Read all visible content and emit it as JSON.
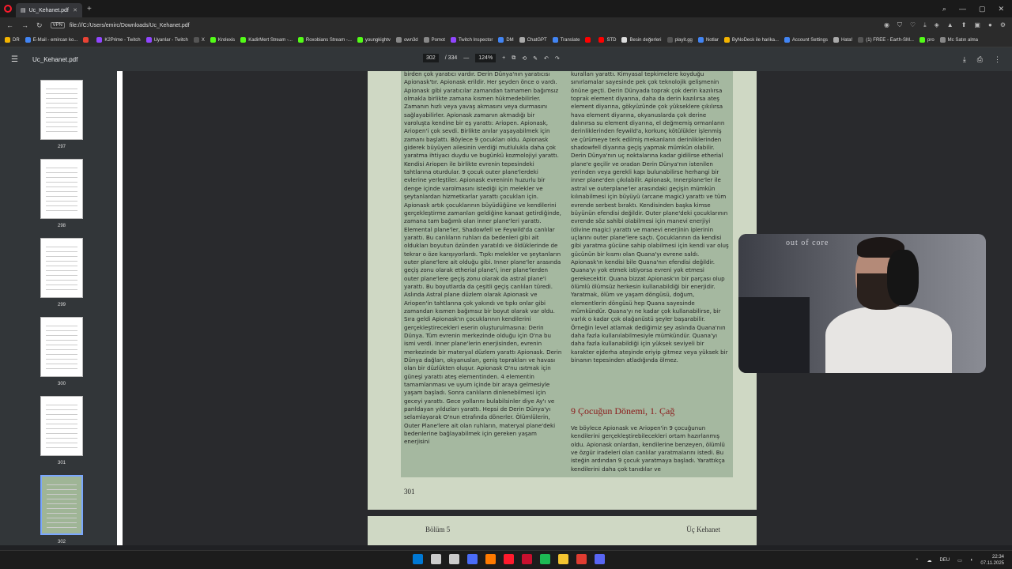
{
  "browser": {
    "tab_title": "Uc_Kehanet.pdf",
    "url": "file:///C:/Users/emirc/Downloads/Uc_Kehanet.pdf",
    "url_badge": "VPN"
  },
  "bookmarks": [
    {
      "label": "DR",
      "color": "#f4b400"
    },
    {
      "label": "E-Mail - emircan ko...",
      "color": "#4285f4"
    },
    {
      "label": "",
      "color": "#ea4335"
    },
    {
      "label": "K2Prime - Twitch",
      "color": "#9146ff"
    },
    {
      "label": "Uyarılar - Twitch",
      "color": "#9146ff"
    },
    {
      "label": "X",
      "color": "#555555"
    },
    {
      "label": "Krolexis",
      "color": "#53fc18"
    },
    {
      "label": "KadirMert Stream -...",
      "color": "#53fc18"
    },
    {
      "label": "Roxobians Stream -...",
      "color": "#53fc18"
    },
    {
      "label": "youngkightv",
      "color": "#53fc18"
    },
    {
      "label": "own3d",
      "color": "#888888"
    },
    {
      "label": "Pomot",
      "color": "#888888"
    },
    {
      "label": "Twitch Inspector",
      "color": "#9146ff"
    },
    {
      "label": "DM",
      "color": "#4285f4"
    },
    {
      "label": "ChatGPT",
      "color": "#aaaaaa"
    },
    {
      "label": "Translate",
      "color": "#4285f4"
    },
    {
      "label": "",
      "color": "#ff0000"
    },
    {
      "label": "STD",
      "color": "#ff0000"
    },
    {
      "label": "Besin değerleri",
      "color": "#dddddd"
    },
    {
      "label": "playit.gg",
      "color": "#555555"
    },
    {
      "label": "Notlar",
      "color": "#4285f4"
    },
    {
      "label": "ByNoDeck ile harika...",
      "color": "#f4b400"
    },
    {
      "label": "Account Settings",
      "color": "#4285f4"
    },
    {
      "label": "Hata!",
      "color": "#aaaaaa"
    },
    {
      "label": "(1) FREE - Earth-SM...",
      "color": "#555555"
    },
    {
      "label": "pro",
      "color": "#53fc18"
    },
    {
      "label": "Mc Satın alma",
      "color": "#888888"
    }
  ],
  "pdf": {
    "file_name": "Uc_Kehanet.pdf",
    "current_page": "302",
    "total_pages": "/ 334",
    "zoom": "124%"
  },
  "thumbnails": [
    {
      "num": "297"
    },
    {
      "num": "298"
    },
    {
      "num": "299"
    },
    {
      "num": "300"
    },
    {
      "num": "301"
    },
    {
      "num": "302"
    }
  ],
  "page_content": {
    "col1": "birden çok yaratıcı vardır. Derin Dünya'nın yaratıcısı Apionask'tır. Apionask erildir. Her şeyden önce o vardı. Apionask gibi yaratıcılar zamandan tamamen bağımsız olmakla birlikte zamana kısmen hükmedebilirler. Zamanın hızlı veya yavaş akmasını veya durmasını sağlayabilirler. Apionask zamanın akmadığı bir varoluşta kendine bir eş yarattı: Ariopen. Apionask, Ariopen'i çok sevdi. Birlikte anılar yaşayabilmek için zamanı başlattı. Böylece 9 çocukları oldu. Apionask giderek büyüyen ailesinin verdiği mutlulukla daha çok yaratma ihtiyacı duydu ve bugünkü kozmolojiyi yarattı. Kendisi Ariopen ile birlikte evrenin tepesindeki tahtlarına oturdular. 9 çocuk outer plane'lerdeki evlerine yerleştiler. Apionask evreninin huzurlu bir denge içinde varolmasını istediği için melekler ve şeytanlardan hizmetkarlar yarattı çocukları için. Apionask artık çocuklarının büyüdüğüne ve kendilerini gerçekleştirme zamanları geldiğine kanaat getirdiğinde, zamana tam bağımlı olan inner plane'leri yarattı. Elemental plane'ler, Shadowfell ve Feywild'da canlılar yarattı. Bu canlıların ruhları da bedenleri gibi ait oldukları boyutun özünden yaratıldı ve öldüklerinde de tekrar o öze karışıyorlardı. Tıpkı melekler ve şeytanların outer plane'lere ait olduğu gibi. Inner plane'ler arasında geçiş zonu olarak etherial plane'i, iner plane'lerden outer plane'lere geçiş zonu olarak da astral plane'i yarattı. Bu boyutlarda da çeşitli geçiş canlıları türedi. Aslında Astral plane düzlem olarak Apionask ve Ariopen'in tahtlarına çok yakındı ve tıpkı onlar gibi zamandan kısmen bağımsız bir boyut olarak var oldu. Sıra geldi Apionask'ın çocuklarının kendilerini gerçekleştirecekleri eserin oluşturulmasına: Derin Dünya. Tüm evrenin merkezinde olduğu için O'na bu ismi verdi. Inner plane'lerin enerjisinden, evrenin merkezinde bir materyal düzlem yarattı Apionask. Derin Dünya dağları, okyanusları, geniş toprakları ve havası olan bir düzlükten oluşur. Apionask O'nu ısıtmak için güneşi yarattı ateş elementinden. 4 elementin tamamlanması ve uyum içinde bir araya gelmesiyle yaşam başladı. Sonra canlıların dinlenebilmesi için geceyi yarattı. Gece yollarını bulabilsinler diye Ay'ı ve parıldayan yıldızları yarattı. Hepsi de Derin Dünya'yı selamlayarak O'nun etrafında dönerler. Ölümlülerin, Outer Plane'lere ait olan ruhların, materyal plane'deki bedenlerine bağlayabilmek için gereken yaşam enerjisini",
    "col2": "kuralları yarattı. Kimyasal tepkimelere koyduğu sınırlamalar sayesinde pek çok teknolojik gelişmenin önüne geçti. Derin Dünyada toprak çok derin kazılırsa toprak element diyarına, daha da derin kazılırsa ateş element diyarına, gökyüzünde çok yükseklere çıkılırsa hava element diyarına, okyanuslarda çok derine dalınırsa su element diyarına, el değmemiş ormanların derinliklerinden feywild'a, korkunç kötülükler işlenmiş ve çürümeye terk edilmiş mekanların derinliklerinden shadowfell diyarına geçiş yapmak mümkün olabilir. Derin Dünya'nın uç noktalarına kadar gidilirse etherial plane'e geçilir ve oradan Derin Dünya'nın istenilen yerinden veya gerekli kapı bulunabilirse herhangi bir inner plane'den çıkılabilir. Apionask, Innerplane'ler ile astral ve outerplane'ler arasındaki geçişin mümkün kılınabilmesi için büyüyü (arcane magic) yarattı ve tüm evrende serbest bıraktı. Kendisinden başka kimse büyünün efendisi değildir. Outer plane'deki çocuklarının evrende söz sahibi olabilmesi için manevi enerjiyi (divine magic) yarattı ve manevi enerjinin iplerinin uçlarını outer plane'lere saçtı. Çocuklarının da kendisi gibi yaratma gücüne sahip olabilmesi için kendi var oluş gücünün bir kısmı olan Quana'yı evrene saldı. Apionask'ın kendisi bile Quana'nın efendisi değildir. Quana'yı yok etmek istiyorsa evreni yok etmesi gerekecektir. Quana bizzat Apionask'ın bir parçası olup ölümlü ölümsüz herkesin kullanabildiği bir enerjidir. Yaratmak, ölüm ve yaşam döngüsü, doğum, elementlerin döngüsü hep Quana sayesinde mümkündür. Quana'yı ne kadar çok kullanabilirse, bir varlık o kadar çok olağanüstü şeyler başarabilir. Örneğin level atlamak dediğimiz şey aslında Quana'nın daha fazla kullanılabilmesiyle mümkündür. Quana'yı daha fazla kullanabildiği için yüksek seviyeli bir karakter ejderha ateşinde eriyip gitmez veya yüksek bir binanın tepesinden atladığında ölmez.",
    "heading": "9 Çocuğun Dönemi, 1. Çağ",
    "col3": "Ve böylece Apionask ve Ariopen'in 9 çocuğunun kendilerini gerçekleştirebilecekleri ortam hazırlanmış oldu. Apionask onlardan, kendilerine benzeyen, ölümlü ve özgür iradeleri olan canlılar yaratmalarını istedi. Bu isteğin ardından 9 çocuk yaratmaya başladı. Yarattıkça kendilerini daha çok tanıdılar ve",
    "page_number": "301",
    "next_left_header": "Bölüm 5",
    "next_right_header": "Üç Kehanet"
  },
  "webcam": {
    "wall_text": "out of core"
  },
  "taskbar": {
    "lang": "DEU",
    "time": "22:34",
    "date": "07.11.2025",
    "icons": [
      "#0078d4",
      "#cccccc",
      "#cccccc",
      "#4a6cf7",
      "#ff7a00",
      "#ff1b2d",
      "#c8102e",
      "#1db954",
      "#f4c430",
      "#e03c31",
      "#5865f2"
    ]
  }
}
